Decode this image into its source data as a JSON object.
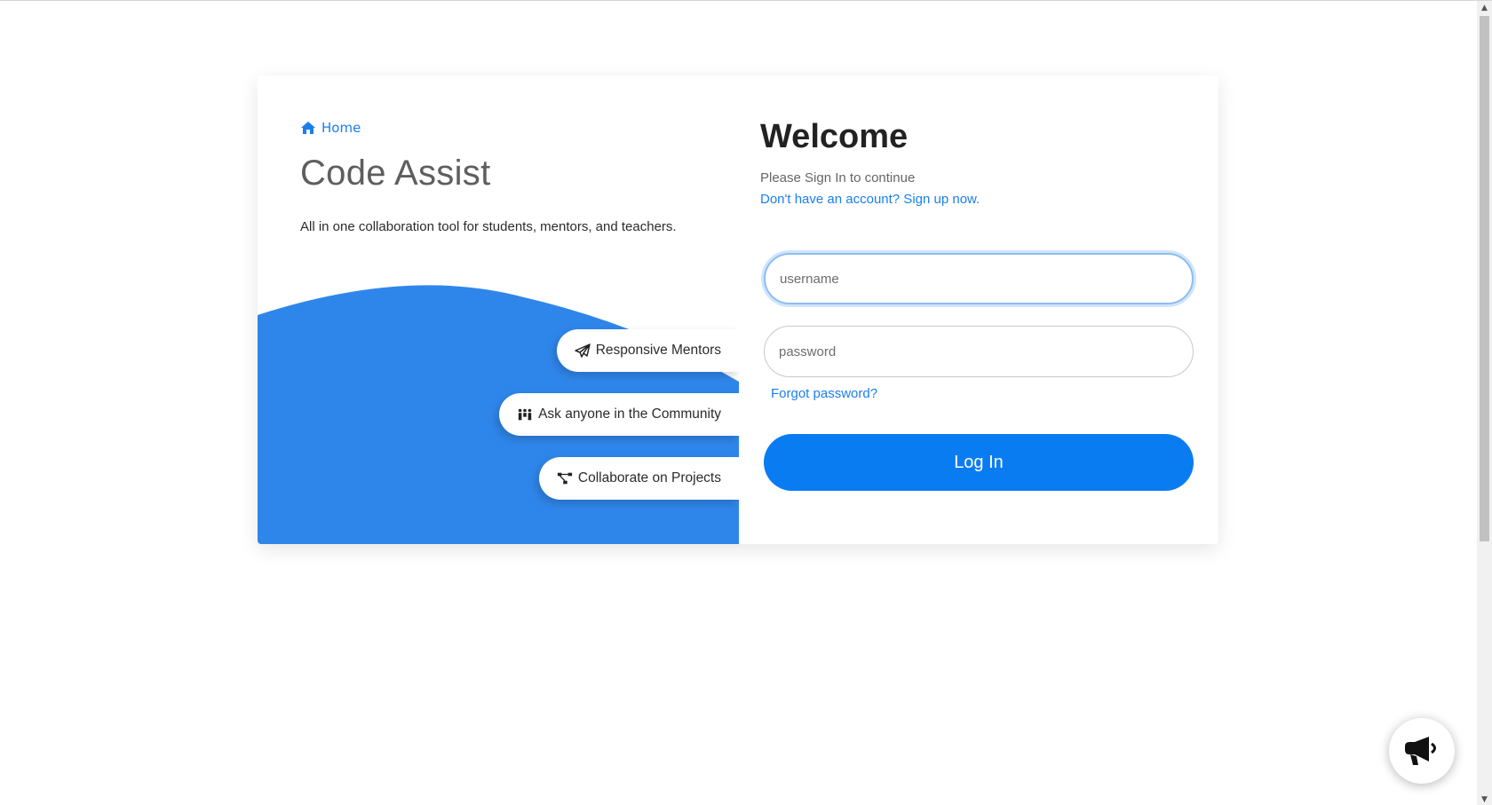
{
  "left": {
    "home_label": "Home",
    "brand": "Code Assist",
    "tagline": "All in one collaboration tool for students, mentors, and teachers.",
    "features": [
      {
        "label": "Responsive Mentors",
        "icon": "paper-plane-icon"
      },
      {
        "label": "Ask anyone in the Community",
        "icon": "people-icon"
      },
      {
        "label": "Collaborate on Projects",
        "icon": "project-diagram-icon"
      }
    ]
  },
  "right": {
    "welcome": "Welcome",
    "subtext": "Please Sign In to continue",
    "signup_link": "Don't have an account? Sign up now.",
    "username_placeholder": "username",
    "password_placeholder": "password",
    "forgot_link": "Forgot password?",
    "login_button": "Log In"
  },
  "floating": {
    "icon": "megaphone-icon"
  },
  "colors": {
    "accent": "#0a7cf2",
    "link": "#1a7ef0",
    "panel_blue": "#2f86ea"
  }
}
